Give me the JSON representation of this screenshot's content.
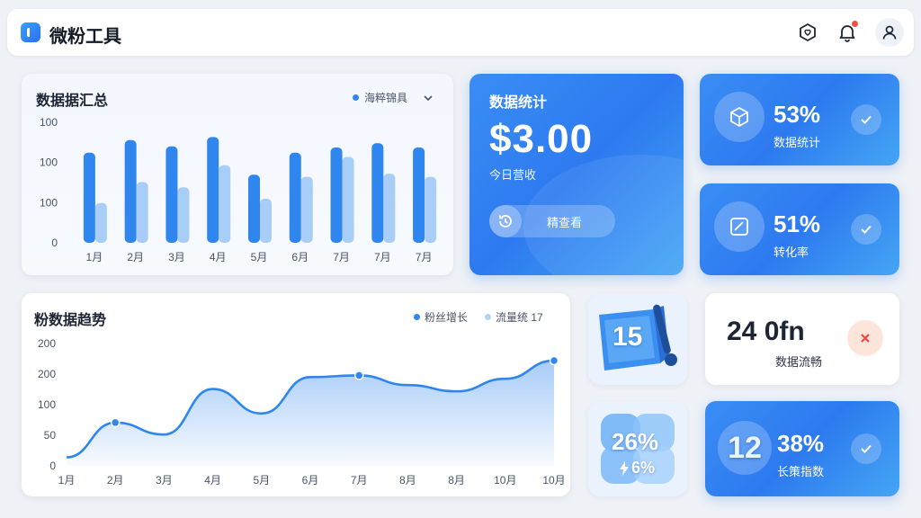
{
  "app": {
    "title": "微粉工具"
  },
  "header_icons": [
    "shield-heart-icon",
    "bell-icon",
    "user-icon"
  ],
  "summary_card": {
    "title": "数据据汇总",
    "legend_label": "海粹锦具",
    "chart_data": {
      "type": "bar",
      "categories": [
        "1月",
        "2月",
        "3月",
        "4月",
        "5月",
        "6月",
        "7月",
        "7月",
        "7月"
      ],
      "y_tick_labels": [
        "100",
        "100",
        "100",
        "0"
      ],
      "series": [
        {
          "values": [
            86,
            98,
            92,
            101,
            65,
            86,
            91,
            95,
            91
          ],
          "color": "#2f86ee"
        },
        {
          "values": [
            38,
            58,
            53,
            74,
            42,
            63,
            82,
            66,
            63
          ],
          "color": "#a8cdf7"
        }
      ],
      "ylim": [
        0,
        115
      ]
    }
  },
  "stats_card": {
    "title": "数据统计",
    "amount": "$3.00",
    "subtitle": "今日营收",
    "button_label": "精查看"
  },
  "mini_cards": [
    {
      "value": "53%",
      "label": "数据统计",
      "icon": "cube-icon"
    },
    {
      "value": "51%",
      "label": "转化率",
      "icon": "chart-frame-icon"
    }
  ],
  "trend_card": {
    "title": "粉数据趋势",
    "legend": [
      {
        "label": "粉丝增长",
        "color": "#2f86ee"
      },
      {
        "label": "流量统 17",
        "color": "#b4d3f8"
      }
    ],
    "chart_data": {
      "type": "area",
      "x": [
        "1月",
        "2月",
        "3月",
        "4月",
        "5月",
        "6月",
        "7月",
        "8月",
        "8月",
        "10月",
        "10月"
      ],
      "y_tick_labels": [
        "200",
        "200",
        "100",
        "50",
        "0"
      ],
      "values": [
        15,
        76,
        55,
        135,
        92,
        156,
        159,
        142,
        131,
        153,
        185
      ],
      "highlighted_points": [
        1,
        6,
        10
      ],
      "ylim": [
        0,
        215
      ]
    }
  },
  "tiles": {
    "tile_a": {
      "value": "15"
    },
    "tile_b": {
      "value": "26%",
      "sub": "6%"
    }
  },
  "score_card": {
    "value": "24 0fn",
    "label": "数据流畅"
  },
  "bottom_card": {
    "big": "12",
    "value": "38%",
    "label": "长策指数"
  }
}
